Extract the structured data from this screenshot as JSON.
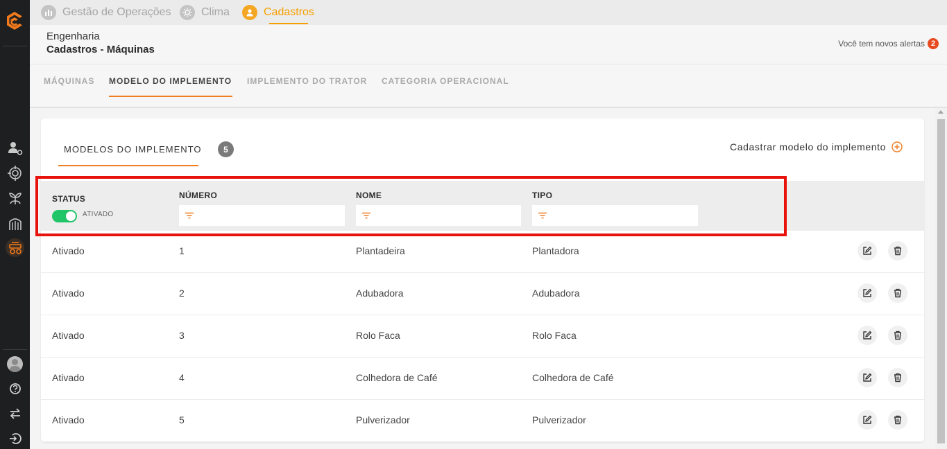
{
  "sidebar": {
    "icons": [
      "logo-icon",
      "user-gear-icon",
      "target-icon",
      "plant-icon",
      "silo-icon",
      "tractor-icon",
      "avatar",
      "help-icon",
      "swap-icon",
      "logout-icon"
    ]
  },
  "topnav": {
    "items": [
      {
        "label": "Gestão de Operações",
        "icon": "chart-icon"
      },
      {
        "label": "Clima",
        "icon": "sun-icon"
      },
      {
        "label": "Cadastros",
        "icon": "user-icon"
      }
    ],
    "active_color": "#f5a000"
  },
  "header": {
    "subtitle": "Engenharia",
    "title": "Cadastros - Máquinas",
    "alerts_label": "Você tem novos alertas",
    "alerts_count": "2"
  },
  "subtabs": [
    "MÁQUINAS",
    "MODELO DO IMPLEMENTO",
    "IMPLEMENTO DO TRATOR",
    "CATEGORIA OPERACIONAL"
  ],
  "card": {
    "tab_label": "MODELOS DO IMPLEMENTO",
    "count": "5",
    "register_label": "Cadastrar modelo do implemento"
  },
  "table": {
    "columns": {
      "status": "STATUS",
      "numero": "NÚMERO",
      "nome": "NOME",
      "tipo": "TIPO"
    },
    "status_filter_label": "ATIVADO",
    "rows": [
      {
        "status": "Ativado",
        "numero": "1",
        "nome": "Plantadeira",
        "tipo": "Plantadora"
      },
      {
        "status": "Ativado",
        "numero": "2",
        "nome": "Adubadora",
        "tipo": "Adubadora"
      },
      {
        "status": "Ativado",
        "numero": "3",
        "nome": "Rolo Faca",
        "tipo": "Rolo Faca"
      },
      {
        "status": "Ativado",
        "numero": "4",
        "nome": "Colhedora de Café",
        "tipo": "Colhedora de Café"
      },
      {
        "status": "Ativado",
        "numero": "5",
        "nome": "Pulverizador",
        "tipo": "Pulverizador"
      }
    ]
  },
  "colors": {
    "accent": "#ef7d22",
    "toggle_on": "#1fc566",
    "highlight": "#e8120c"
  }
}
